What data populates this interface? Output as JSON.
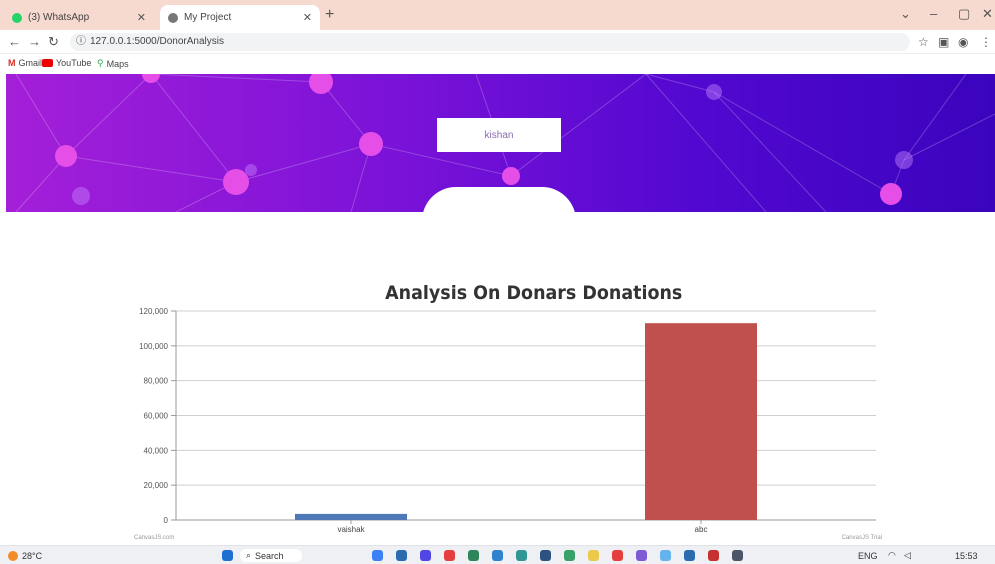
{
  "browser": {
    "tabs": [
      {
        "label": "(3) WhatsApp",
        "icon": "whatsapp-icon",
        "color": "#25d366"
      },
      {
        "label": "My Project",
        "icon": "globe-icon",
        "color": "#555555"
      }
    ],
    "address": "127.0.0.1:5000/DonorAnalysis",
    "bookmarks": [
      "Gmail",
      "YouTube",
      "Maps"
    ]
  },
  "page": {
    "username": "kishan"
  },
  "chart_data": {
    "type": "bar",
    "title": "Analysis On Donars Donations",
    "categories": [
      "vaishak",
      "abc"
    ],
    "values": [
      3500,
      113000
    ],
    "colors": [
      "#4f78b6",
      "#c0504d"
    ],
    "ylim": [
      0,
      120000
    ],
    "yticks": [
      "0",
      "20,000",
      "40,000",
      "60,000",
      "80,000",
      "100,000",
      "120,000"
    ],
    "grid": true,
    "footer_left": "CanvasJS.com",
    "footer_right": "CanvasJS Trial"
  },
  "taskbar": {
    "weather": "28°C",
    "search": "Search",
    "lang": "ENG",
    "time": "15:53"
  }
}
